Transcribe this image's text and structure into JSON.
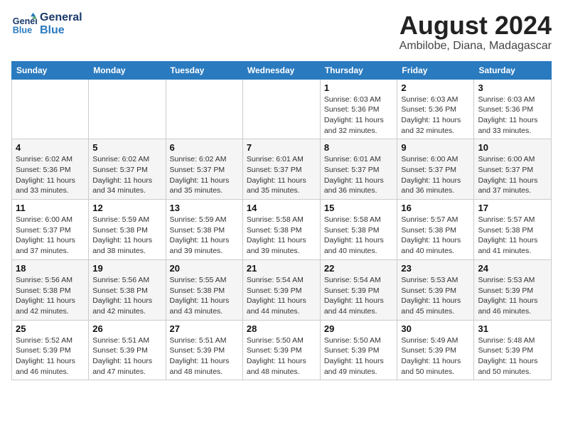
{
  "header": {
    "logo_line1": "General",
    "logo_line2": "Blue",
    "month_year": "August 2024",
    "location": "Ambilobe, Diana, Madagascar"
  },
  "weekdays": [
    "Sunday",
    "Monday",
    "Tuesday",
    "Wednesday",
    "Thursday",
    "Friday",
    "Saturday"
  ],
  "weeks": [
    [
      {
        "day": "",
        "info": ""
      },
      {
        "day": "",
        "info": ""
      },
      {
        "day": "",
        "info": ""
      },
      {
        "day": "",
        "info": ""
      },
      {
        "day": "1",
        "info": "Sunrise: 6:03 AM\nSunset: 5:36 PM\nDaylight: 11 hours\nand 32 minutes."
      },
      {
        "day": "2",
        "info": "Sunrise: 6:03 AM\nSunset: 5:36 PM\nDaylight: 11 hours\nand 32 minutes."
      },
      {
        "day": "3",
        "info": "Sunrise: 6:03 AM\nSunset: 5:36 PM\nDaylight: 11 hours\nand 33 minutes."
      }
    ],
    [
      {
        "day": "4",
        "info": "Sunrise: 6:02 AM\nSunset: 5:36 PM\nDaylight: 11 hours\nand 33 minutes."
      },
      {
        "day": "5",
        "info": "Sunrise: 6:02 AM\nSunset: 5:37 PM\nDaylight: 11 hours\nand 34 minutes."
      },
      {
        "day": "6",
        "info": "Sunrise: 6:02 AM\nSunset: 5:37 PM\nDaylight: 11 hours\nand 35 minutes."
      },
      {
        "day": "7",
        "info": "Sunrise: 6:01 AM\nSunset: 5:37 PM\nDaylight: 11 hours\nand 35 minutes."
      },
      {
        "day": "8",
        "info": "Sunrise: 6:01 AM\nSunset: 5:37 PM\nDaylight: 11 hours\nand 36 minutes."
      },
      {
        "day": "9",
        "info": "Sunrise: 6:00 AM\nSunset: 5:37 PM\nDaylight: 11 hours\nand 36 minutes."
      },
      {
        "day": "10",
        "info": "Sunrise: 6:00 AM\nSunset: 5:37 PM\nDaylight: 11 hours\nand 37 minutes."
      }
    ],
    [
      {
        "day": "11",
        "info": "Sunrise: 6:00 AM\nSunset: 5:37 PM\nDaylight: 11 hours\nand 37 minutes."
      },
      {
        "day": "12",
        "info": "Sunrise: 5:59 AM\nSunset: 5:38 PM\nDaylight: 11 hours\nand 38 minutes."
      },
      {
        "day": "13",
        "info": "Sunrise: 5:59 AM\nSunset: 5:38 PM\nDaylight: 11 hours\nand 39 minutes."
      },
      {
        "day": "14",
        "info": "Sunrise: 5:58 AM\nSunset: 5:38 PM\nDaylight: 11 hours\nand 39 minutes."
      },
      {
        "day": "15",
        "info": "Sunrise: 5:58 AM\nSunset: 5:38 PM\nDaylight: 11 hours\nand 40 minutes."
      },
      {
        "day": "16",
        "info": "Sunrise: 5:57 AM\nSunset: 5:38 PM\nDaylight: 11 hours\nand 40 minutes."
      },
      {
        "day": "17",
        "info": "Sunrise: 5:57 AM\nSunset: 5:38 PM\nDaylight: 11 hours\nand 41 minutes."
      }
    ],
    [
      {
        "day": "18",
        "info": "Sunrise: 5:56 AM\nSunset: 5:38 PM\nDaylight: 11 hours\nand 42 minutes."
      },
      {
        "day": "19",
        "info": "Sunrise: 5:56 AM\nSunset: 5:38 PM\nDaylight: 11 hours\nand 42 minutes."
      },
      {
        "day": "20",
        "info": "Sunrise: 5:55 AM\nSunset: 5:38 PM\nDaylight: 11 hours\nand 43 minutes."
      },
      {
        "day": "21",
        "info": "Sunrise: 5:54 AM\nSunset: 5:39 PM\nDaylight: 11 hours\nand 44 minutes."
      },
      {
        "day": "22",
        "info": "Sunrise: 5:54 AM\nSunset: 5:39 PM\nDaylight: 11 hours\nand 44 minutes."
      },
      {
        "day": "23",
        "info": "Sunrise: 5:53 AM\nSunset: 5:39 PM\nDaylight: 11 hours\nand 45 minutes."
      },
      {
        "day": "24",
        "info": "Sunrise: 5:53 AM\nSunset: 5:39 PM\nDaylight: 11 hours\nand 46 minutes."
      }
    ],
    [
      {
        "day": "25",
        "info": "Sunrise: 5:52 AM\nSunset: 5:39 PM\nDaylight: 11 hours\nand 46 minutes."
      },
      {
        "day": "26",
        "info": "Sunrise: 5:51 AM\nSunset: 5:39 PM\nDaylight: 11 hours\nand 47 minutes."
      },
      {
        "day": "27",
        "info": "Sunrise: 5:51 AM\nSunset: 5:39 PM\nDaylight: 11 hours\nand 48 minutes."
      },
      {
        "day": "28",
        "info": "Sunrise: 5:50 AM\nSunset: 5:39 PM\nDaylight: 11 hours\nand 48 minutes."
      },
      {
        "day": "29",
        "info": "Sunrise: 5:50 AM\nSunset: 5:39 PM\nDaylight: 11 hours\nand 49 minutes."
      },
      {
        "day": "30",
        "info": "Sunrise: 5:49 AM\nSunset: 5:39 PM\nDaylight: 11 hours\nand 50 minutes."
      },
      {
        "day": "31",
        "info": "Sunrise: 5:48 AM\nSunset: 5:39 PM\nDaylight: 11 hours\nand 50 minutes."
      }
    ]
  ]
}
